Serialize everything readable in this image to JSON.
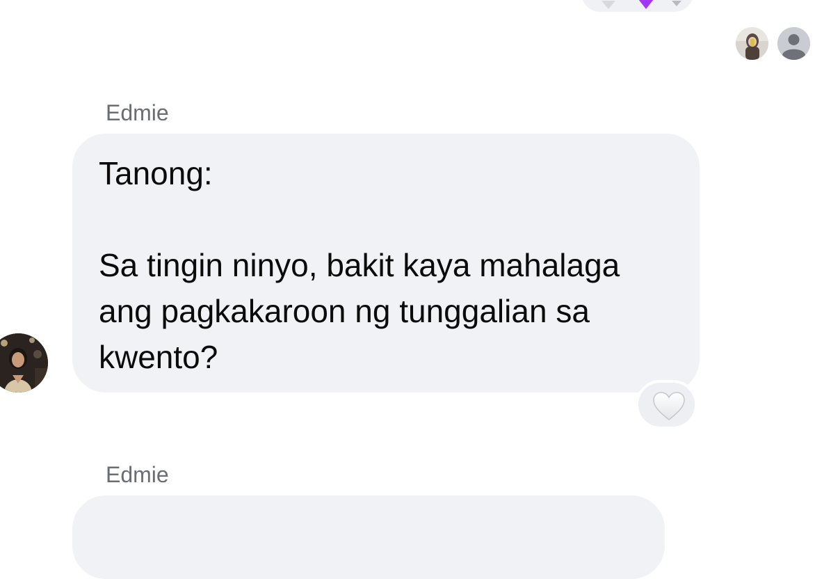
{
  "messages": [
    {
      "sender": "Edmie",
      "lines": [
        "Tanong:",
        "",
        "Sa tingin ninyo, bakit kaya mahalaga",
        "ang pagkakaroon ng tunggalian sa",
        "kwento?"
      ],
      "reaction": {
        "icon": "white-heart-icon"
      }
    },
    {
      "sender": "Edmie",
      "preview_text": ""
    }
  ],
  "seen_by": [
    {
      "icon": "user-photo-avatar"
    },
    {
      "icon": "default-user-avatar"
    }
  ],
  "colors": {
    "bubble": "#f1f2f6",
    "sender_name": "#6a6d73",
    "text": "#0b0b0c",
    "reaction_purple": "#a238f5"
  }
}
